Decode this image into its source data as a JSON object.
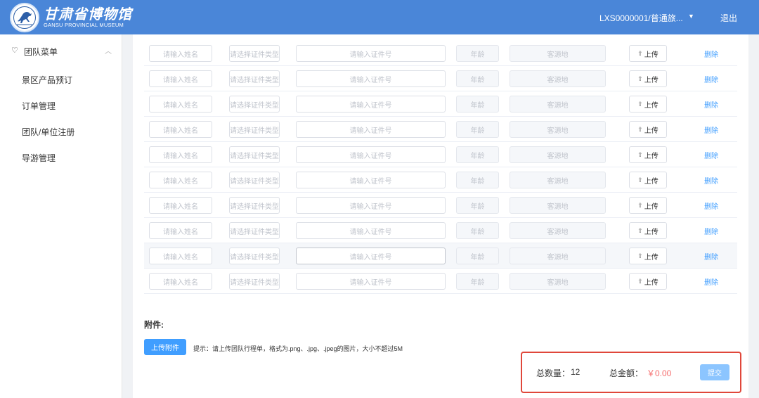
{
  "header": {
    "logo_cn": "甘肃省博物馆",
    "logo_en": "GANSU PROVINCIAL MUSEUM",
    "user": "LXS0000001/普通旅...",
    "logout": "退出"
  },
  "sidebar": {
    "group": "团队菜单",
    "items": [
      "景区产品预订",
      "订单管理",
      "团队/单位注册",
      "导游管理"
    ]
  },
  "table": {
    "placeholders": {
      "name": "请输入姓名",
      "type": "请选择证件类型",
      "id": "请输入证件号",
      "age": "年龄",
      "origin": "客源地"
    },
    "upload_label": "上传",
    "delete_label": "删除",
    "visible_rows": 10,
    "highlighted_row_index": 8
  },
  "attachment": {
    "label": "附件:",
    "button": "上传附件",
    "hint": "提示：请上传团队行程单，格式为.png、.jpg、.jpeg的图片，大小不超过5M"
  },
  "summary": {
    "qty_label": "总数量：",
    "qty_value": "12",
    "amount_label": "总金额：",
    "amount_value": "￥0.00",
    "submit": "提交"
  },
  "colors": {
    "header": "#4a86d8",
    "primary": "#409eff",
    "highlight_border": "#e0473a",
    "price": "#f56c6c"
  }
}
